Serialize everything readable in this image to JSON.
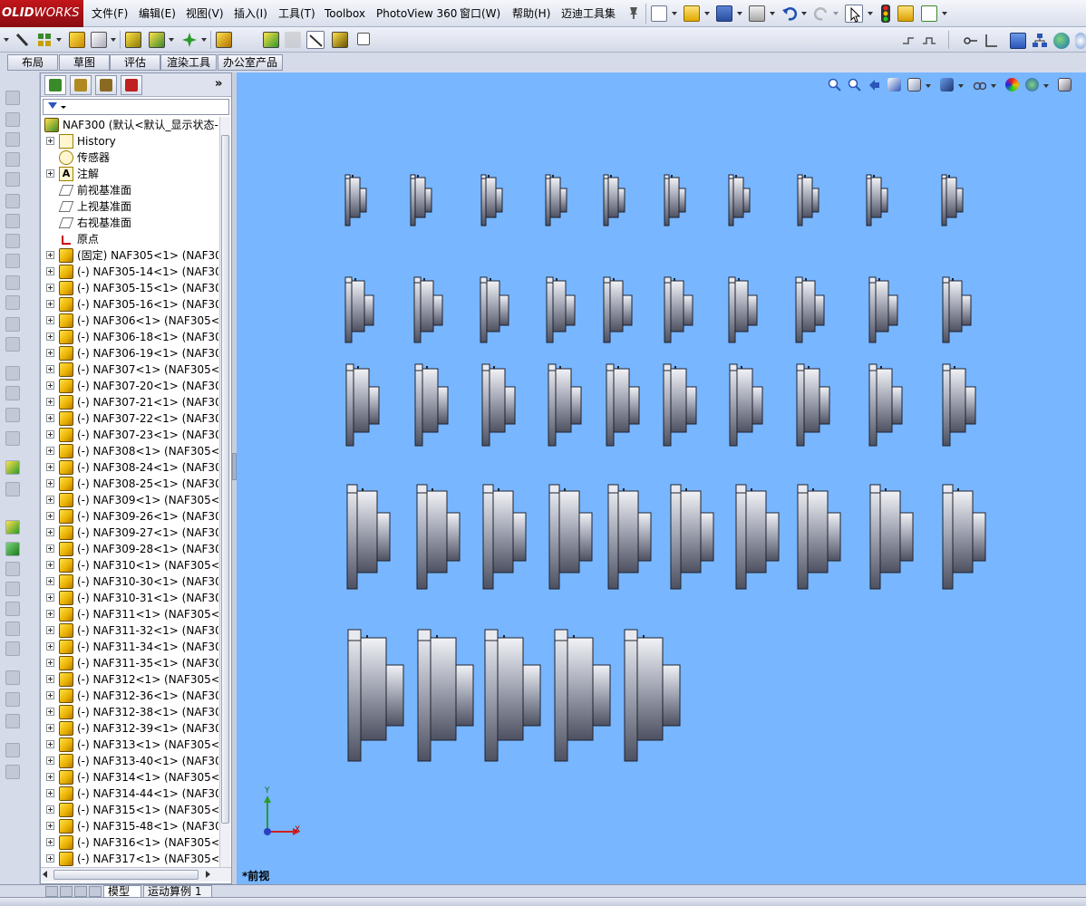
{
  "app": {
    "logo_bold": "OLID",
    "logo_rest": "WORKS"
  },
  "menu": [
    {
      "label": "文件(F)"
    },
    {
      "label": "编辑(E)"
    },
    {
      "label": "视图(V)"
    },
    {
      "label": "插入(I)"
    },
    {
      "label": "工具(T)"
    },
    {
      "label": "Toolbox"
    },
    {
      "label": "PhotoView 360"
    },
    {
      "label": "窗口(W)"
    },
    {
      "label": "帮助(H)"
    },
    {
      "label": "迈迪工具集"
    }
  ],
  "command_tabs": [
    {
      "label": "布局",
      "active": false
    },
    {
      "label": "草图",
      "active": false
    },
    {
      "label": "评估",
      "active": false
    },
    {
      "label": "渲染工具",
      "active": false
    },
    {
      "label": "办公室产品",
      "active": false
    }
  ],
  "feature_manager": {
    "more_label": "»",
    "tabs": [
      {
        "icon": "feature-tree-icon",
        "color": "#3a8a2a"
      },
      {
        "icon": "property-manager-icon",
        "color": "#b08a20"
      },
      {
        "icon": "configuration-manager-icon",
        "color": "#8a6a20"
      },
      {
        "icon": "display-manager-icon",
        "color": "#c02020"
      }
    ],
    "root": {
      "label": "NAF300  (默认<默认_显示状态-"
    },
    "items": [
      {
        "label": "History",
        "icon": "history-icon",
        "expandable": true
      },
      {
        "label": "传感器",
        "icon": "sensor-icon",
        "expandable": false
      },
      {
        "label": "注解",
        "icon": "annotation-icon",
        "expandable": true
      },
      {
        "label": "前视基准面",
        "icon": "plane-icon",
        "expandable": false
      },
      {
        "label": "上视基准面",
        "icon": "plane-icon",
        "expandable": false
      },
      {
        "label": "右视基准面",
        "icon": "plane-icon",
        "expandable": false
      },
      {
        "label": "原点",
        "icon": "origin-icon",
        "expandable": false
      },
      {
        "label": "(固定) NAF305<1> (NAF30",
        "icon": "part-icon",
        "expandable": true
      },
      {
        "label": "(-) NAF305-14<1> (NAF30",
        "icon": "part-icon",
        "expandable": true
      },
      {
        "label": "(-) NAF305-15<1> (NAF30",
        "icon": "part-icon",
        "expandable": true
      },
      {
        "label": "(-) NAF305-16<1> (NAF30",
        "icon": "part-icon",
        "expandable": true
      },
      {
        "label": "(-) NAF306<1> (NAF305<",
        "icon": "part-icon",
        "expandable": true
      },
      {
        "label": "(-) NAF306-18<1> (NAF30",
        "icon": "part-icon",
        "expandable": true
      },
      {
        "label": "(-) NAF306-19<1> (NAF30",
        "icon": "part-icon",
        "expandable": true
      },
      {
        "label": "(-) NAF307<1> (NAF305<",
        "icon": "part-icon",
        "expandable": true
      },
      {
        "label": "(-) NAF307-20<1> (NAF30",
        "icon": "part-icon",
        "expandable": true
      },
      {
        "label": "(-) NAF307-21<1> (NAF30",
        "icon": "part-icon",
        "expandable": true
      },
      {
        "label": "(-) NAF307-22<1> (NAF30",
        "icon": "part-icon",
        "expandable": true
      },
      {
        "label": "(-) NAF307-23<1> (NAF30",
        "icon": "part-icon",
        "expandable": true
      },
      {
        "label": "(-) NAF308<1> (NAF305<",
        "icon": "part-icon",
        "expandable": true
      },
      {
        "label": "(-) NAF308-24<1> (NAF30",
        "icon": "part-icon",
        "expandable": true
      },
      {
        "label": "(-) NAF308-25<1> (NAF30",
        "icon": "part-icon",
        "expandable": true
      },
      {
        "label": "(-) NAF309<1> (NAF305<",
        "icon": "part-icon",
        "expandable": true
      },
      {
        "label": "(-) NAF309-26<1> (NAF30",
        "icon": "part-icon",
        "expandable": true
      },
      {
        "label": "(-) NAF309-27<1> (NAF30",
        "icon": "part-icon",
        "expandable": true
      },
      {
        "label": "(-) NAF309-28<1> (NAF30",
        "icon": "part-icon",
        "expandable": true
      },
      {
        "label": "(-) NAF310<1> (NAF305<",
        "icon": "part-icon",
        "expandable": true
      },
      {
        "label": "(-) NAF310-30<1> (NAF30",
        "icon": "part-icon",
        "expandable": true
      },
      {
        "label": "(-) NAF310-31<1> (NAF30",
        "icon": "part-icon",
        "expandable": true
      },
      {
        "label": "(-) NAF311<1> (NAF305<",
        "icon": "part-icon",
        "expandable": true
      },
      {
        "label": "(-) NAF311-32<1> (NAF30",
        "icon": "part-icon",
        "expandable": true
      },
      {
        "label": "(-) NAF311-34<1> (NAF30",
        "icon": "part-icon",
        "expandable": true
      },
      {
        "label": "(-) NAF311-35<1> (NAF30",
        "icon": "part-icon",
        "expandable": true
      },
      {
        "label": "(-) NAF312<1> (NAF305<",
        "icon": "part-icon",
        "expandable": true
      },
      {
        "label": "(-) NAF312-36<1> (NAF30",
        "icon": "part-icon",
        "expandable": true
      },
      {
        "label": "(-) NAF312-38<1> (NAF30",
        "icon": "part-icon",
        "expandable": true
      },
      {
        "label": "(-) NAF312-39<1> (NAF30",
        "icon": "part-icon",
        "expandable": true
      },
      {
        "label": "(-) NAF313<1> (NAF305<",
        "icon": "part-icon",
        "expandable": true
      },
      {
        "label": "(-) NAF313-40<1> (NAF30",
        "icon": "part-icon",
        "expandable": true
      },
      {
        "label": "(-) NAF314<1> (NAF305<",
        "icon": "part-icon",
        "expandable": true
      },
      {
        "label": "(-) NAF314-44<1> (NAF30",
        "icon": "part-icon",
        "expandable": true
      },
      {
        "label": "(-) NAF315<1> (NAF305<",
        "icon": "part-icon",
        "expandable": true
      },
      {
        "label": "(-) NAF315-48<1> (NAF30",
        "icon": "part-icon",
        "expandable": true
      },
      {
        "label": "(-) NAF316<1> (NAF305<",
        "icon": "part-icon",
        "expandable": true
      },
      {
        "label": "(-) NAF317<1> (NAF305<",
        "icon": "part-icon",
        "expandable": true
      }
    ]
  },
  "graphics": {
    "background": "#78b6ff",
    "view_label": "*前视",
    "triad": {
      "y_label": "Y",
      "x_label": "X"
    },
    "part_rows": [
      10,
      10,
      10,
      10,
      5
    ]
  },
  "bottom_tabs": [
    {
      "label": "模型",
      "active": true
    },
    {
      "label": "运动算例 1",
      "active": false
    }
  ]
}
